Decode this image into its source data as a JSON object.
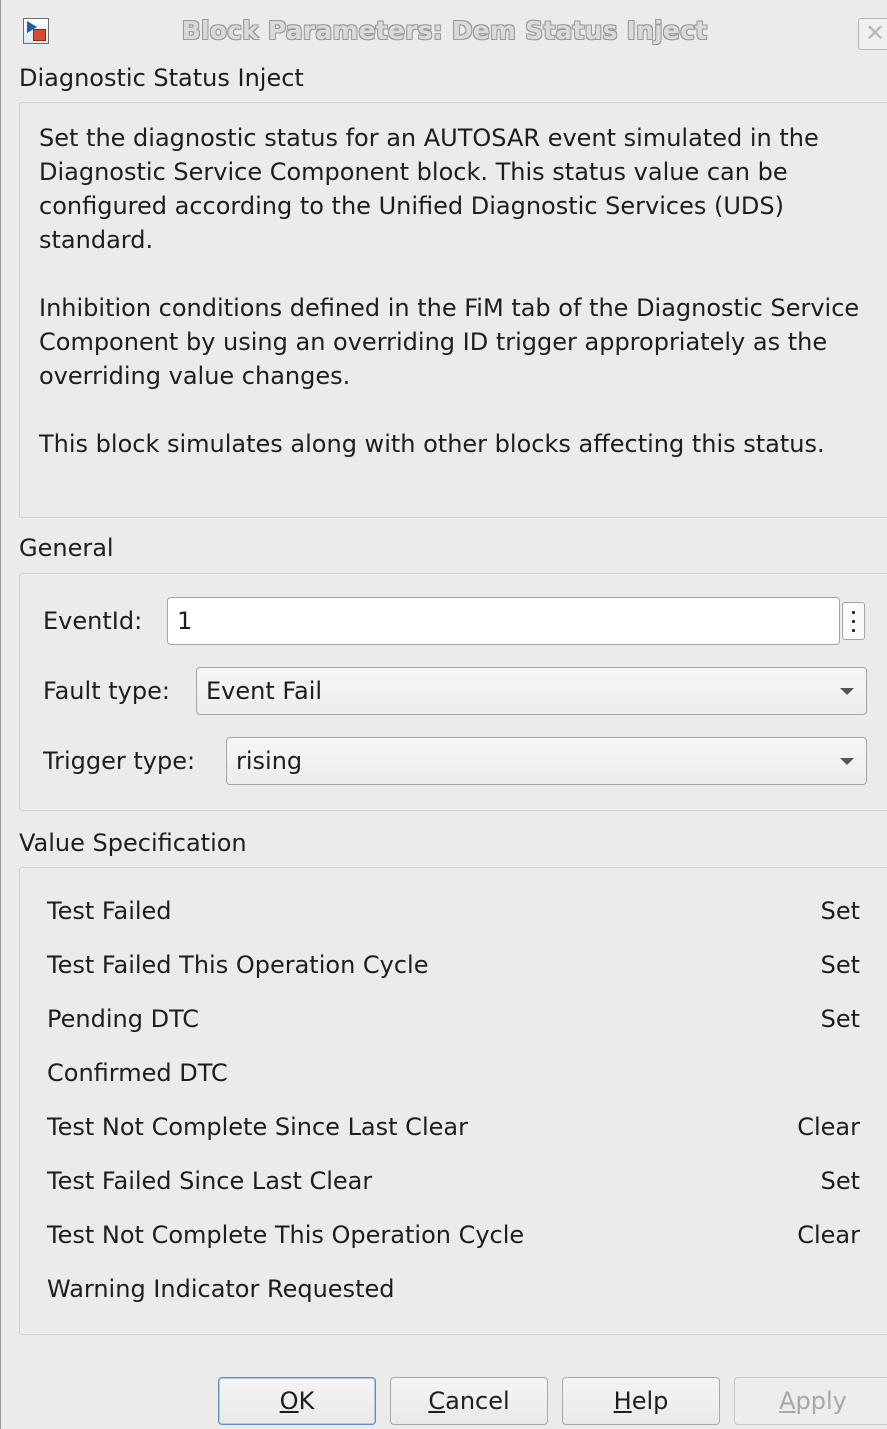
{
  "window": {
    "title": "Block Parameters: Dem Status Inject",
    "close_glyph": "✕"
  },
  "header": {
    "title": "Diagnostic Status Inject",
    "description": [
      "Set the diagnostic status for an AUTOSAR event simulated in the Diagnostic Service Component block. This status value can be configured according to the Unified Diagnostic Services (UDS) standard.",
      "Inhibition conditions defined in the FiM tab of the Diagnostic Service Component by using an overriding ID trigger appropriately as the overriding value changes.",
      "This block simulates along with other blocks affecting this status."
    ]
  },
  "general": {
    "title": "General",
    "event_id_label": "EventId:",
    "event_id_value": "1",
    "fault_type_label": "Fault type:",
    "fault_type_value": "Event Fail",
    "trigger_type_label": "Trigger type:",
    "trigger_type_value": "rising"
  },
  "value_spec": {
    "title": "Value Specification",
    "rows": [
      {
        "label": "Test Failed",
        "value": "Set"
      },
      {
        "label": "Test Failed This Operation Cycle",
        "value": "Set"
      },
      {
        "label": "Pending DTC",
        "value": "Set"
      },
      {
        "label": "Confirmed DTC",
        "value": ""
      },
      {
        "label": "Test Not Complete Since Last Clear",
        "value": "Clear"
      },
      {
        "label": "Test Failed Since Last Clear",
        "value": "Set"
      },
      {
        "label": "Test Not Complete This Operation Cycle",
        "value": "Clear"
      },
      {
        "label": "Warning Indicator Requested",
        "value": ""
      }
    ]
  },
  "buttons": {
    "ok": {
      "mnemonic": "O",
      "rest": "K"
    },
    "cancel": {
      "mnemonic": "C",
      "rest": "ancel"
    },
    "help": {
      "mnemonic": "H",
      "rest": "elp"
    },
    "apply": {
      "mnemonic": "A",
      "rest": "pply"
    }
  },
  "icons": {
    "app": "simulink-block-icon",
    "close": "close-icon",
    "more": "vertical-ellipsis-icon",
    "dropdown": "chevron-down-icon"
  },
  "colors": {
    "window_bg": "#edebe9",
    "default_button_border": "#5f8fc7",
    "disabled_text": "#a9a7a5"
  }
}
